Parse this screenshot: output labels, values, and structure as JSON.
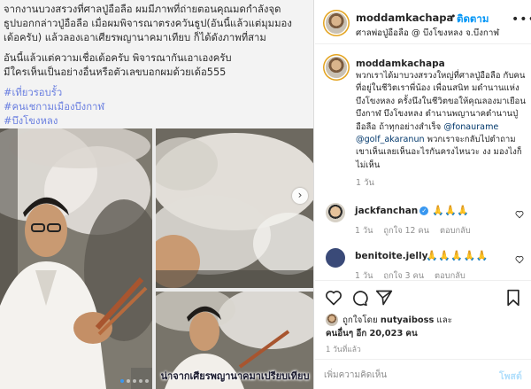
{
  "media": {
    "caption_lines": [
      "จากงานบวงสรวงที่ศาลปู่อือลือ ผมมีภาพที่ถ่ายตอนคุณมดกำลังจุด",
      "ธูปบอกกล่าวปู่อือลือ เมื่อผมพิจารณาตรงควันธูป(อันนี้แล้วแต่มุมมอง",
      "เด้อครับ) แล้วลองเอาเศียรพญานาคมาเทียบ ก็ได้ดังภาพที่สาม"
    ],
    "caption_lines_2": [
      "อันนี้แล้วแต่ความเชื่อเด้อครับ พิจารณากันเอาเองครับ",
      "มีใครเห็นเป็นอย่างอื่นหรือตัวเลขบอกผมด้วยเด้อ555"
    ],
    "hashtags": [
      "#เที่ยวรอบรั้ว",
      "#คนเชกามเมืองบึงกาฬ",
      "#บึงโขงหลง"
    ],
    "subtitle": "น่าจากเศียรพญานาคมาเปรียบเทียบ",
    "carousel_count": 5,
    "carousel_active": 1
  },
  "header": {
    "username": "moddamkachapa",
    "dot": "•",
    "follow_label": "ติดตาม",
    "location": "ศาลพ่อปู่อือลือ @ บึงโขงหลง จ.บึงกาฬ",
    "more_icon": "more-horizontal-icon"
  },
  "caption": {
    "username": "moddamkachapa",
    "text": "พวกเราได้มาบวงสรวงใหญ่ที่ศาลปู่อือลือ กับคนที่อยู่ในชีวิตเราพี่น้อง เพื่อนสนิท มดำนานแห่งบึงโขงหลง ครั้งนึงในชีวิตขอให้คุณลองมาเยือน บึงกาฬ บึงโขงหลง ตำนานพญานาคตำนานปู่อือลือ ถ้าทุกอย่างสำเร็จ",
    "mention_1": "@fonaurame",
    "mention_2": "@golf_akaranun",
    "text_2": "พวกเราจะกลับไปตำถามเขาเห็นเลยเห็นอะไรกันครงไหนวะ งง มองไงก็ไม่เห็น",
    "time": "1 วัน"
  },
  "comments": [
    {
      "username": "jackfanchan",
      "text": "🙏🙏🙏",
      "time": "1 วัน",
      "likes": "ถูกใจ 12 คน",
      "reply": "ตอบกลับ"
    },
    {
      "username": "benitoite.jelly",
      "text": "🙏🙏🙏🙏🙏",
      "time": "1 วัน",
      "likes": "ถูกใจ 3 คน",
      "reply": "ตอบกลับ"
    }
  ],
  "likes": {
    "liked_by_prefix": "ถูกใจโดย",
    "liked_by_user": "nutyaiboss",
    "and": "และ",
    "others_prefix": "คนอื่นๆ อีก",
    "others_count": "20,023",
    "others_suffix": "คน"
  },
  "post_time": "1 วันที่แล้ว",
  "comment_box": {
    "placeholder": "เพิ่มความคิดเห็น",
    "post_label": "โพสต์"
  },
  "colors": {
    "link_blue": "#0095f6",
    "hashtag": "#6a7fe0",
    "muted": "#8e8e8e",
    "story_ring": "#e3a31f"
  }
}
